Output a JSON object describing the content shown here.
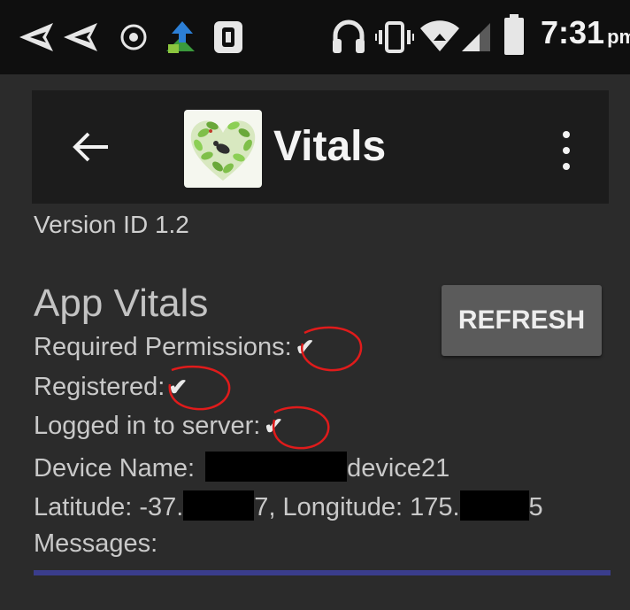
{
  "status_bar": {
    "time": "7:31",
    "ampm": "pm",
    "icons": [
      "send-icon",
      "send-icon",
      "shield-icon",
      "app-update-icon",
      "sim-app-icon",
      "headphones-icon",
      "vibrate-icon",
      "wifi-icon",
      "signal-icon",
      "battery-icon"
    ]
  },
  "app_bar": {
    "title": "Vitals",
    "back_icon": "arrow-left-icon",
    "menu_icon": "more-vertical-icon"
  },
  "version_text": "Version ID 1.2",
  "vitals": {
    "heading": "App Vitals",
    "refresh_label": "REFRESH",
    "required_permissions_label": "Required Permissions:",
    "registered_label": "Registered:",
    "logged_in_label": "Logged in to server:",
    "check": "✔",
    "device_name_label": "Device Name:",
    "device_name_suffix": "device21",
    "latitude_label": "Latitude: -37.",
    "latitude_end": "7",
    "longitude_label": ", Longitude: 175.",
    "longitude_end": "5",
    "messages_label": "Messages:"
  },
  "colors": {
    "background": "#2b2b2b",
    "status_bar": "#0f0f0f",
    "app_bar": "#1c1c1c",
    "button": "#5b5b5b",
    "annotation": "#e01b1b",
    "divider": "#3a3d8c"
  }
}
